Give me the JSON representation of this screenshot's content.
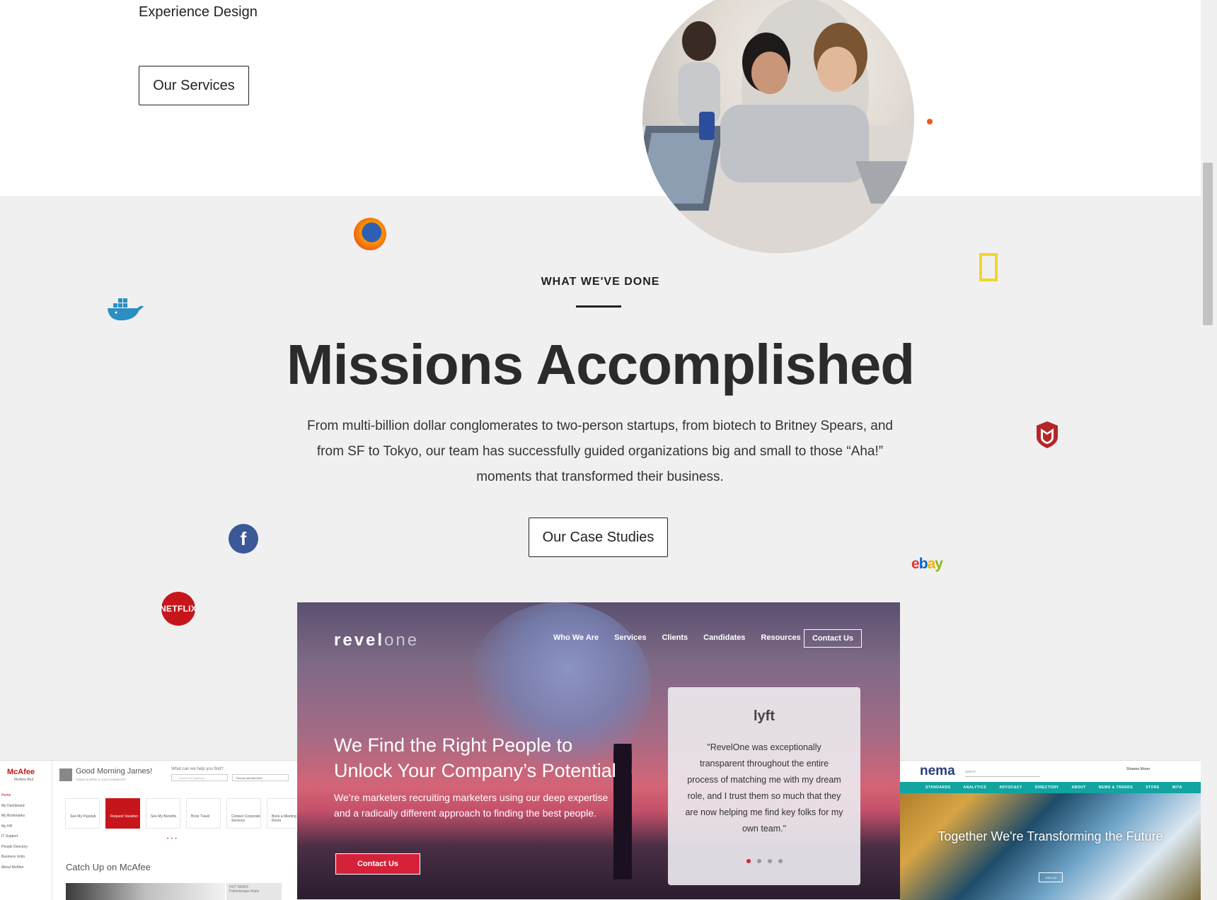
{
  "hero": {
    "experience_label": "Experience Design",
    "services_button": "Our Services"
  },
  "done": {
    "eyebrow": "WHAT WE'VE DONE",
    "headline": "Missions Accomplished",
    "lead": "From multi-billion dollar conglomerates to two-person startups, from biotech to Britney Spears, and from SF to Tokyo, our team has successfully guided organizations big and small to those “Aha!” moments that transformed their business.",
    "cases_button": "Our Case Studies"
  },
  "logos": {
    "netflix": "NETFLIX",
    "ebay": "ebay",
    "facebook": "f"
  },
  "colors": {
    "accent_orange": "#ee5b14",
    "revelone_red": "#d6213a",
    "mcafee_red": "#c7161b",
    "nema_teal": "#11a4a0",
    "background_gray": "#f0f0f0"
  },
  "showcase_revelone": {
    "logo_main": "revel",
    "logo_alt": "one",
    "nav": [
      "Who We Are",
      "Services",
      "Clients",
      "Candidates",
      "Resources"
    ],
    "nav_contact": "Contact Us",
    "headline": "We Find the Right People to Unlock Your Company’s Potential",
    "subhead": "We’re marketers recruiting marketers using our deep expertise and a radically different approach to finding the best people.",
    "cta": "Contact Us",
    "card_logo": "lyft",
    "card_quote": "\"RevelOne was exceptionally transparent throughout the entire process of matching me with my dream role, and I trust them so much that they are now helping me find key folks for my own team.\""
  },
  "showcase_mcafee": {
    "brand": "McAfee",
    "brand_sub": "McAfee Bod",
    "sidebar": [
      "Home",
      "My Dashboard",
      "My Bookmarks",
      "My HR",
      "IT Support",
      "People Directory",
      "Business Units",
      "About McAfee"
    ],
    "greeting": "Good Morning James!",
    "date": "TODAY IS APRIL 6, 2019 | 9:00AM EST",
    "search_label": "What can we help you find?",
    "search_placeholder": "Search for anything...",
    "select_value": "Choose Internal Area",
    "tiles": [
      "See My Paystub",
      "Request Vacation",
      "See My Benefits",
      "Book Travel",
      "Contact Corporate Services",
      "Book a Meeting Room"
    ],
    "pager": "• • •",
    "catch_up": "Catch Up on McAfee",
    "post_label": "HOT NEWS",
    "post_title": "Pellentesque Matis"
  },
  "showcase_nema": {
    "logo": "nema",
    "search_placeholder": "search",
    "user": "Shawna Moser",
    "nav": [
      "STANDARDS",
      "ANALYTICS",
      "ADVOCACY",
      "DIRECTORY",
      "ABOUT",
      "NEWS & TRENDS",
      "STORE",
      "MITA"
    ],
    "hero_text": "Together We're Transforming the Future",
    "join": "JOIN US"
  }
}
